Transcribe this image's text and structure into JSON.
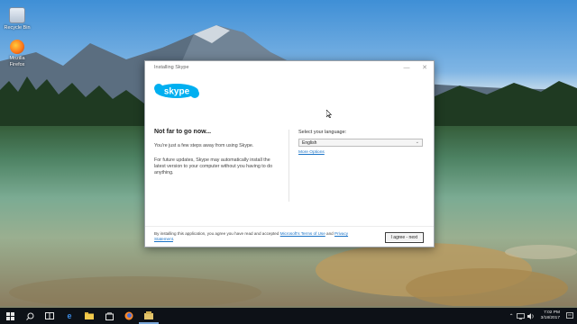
{
  "desktop": {
    "icons": [
      {
        "label": "Recycle Bin",
        "icon": "recycle-bin-icon"
      },
      {
        "label": "Mozilla Firefox",
        "icon": "firefox-icon"
      }
    ]
  },
  "installer": {
    "title": "Installing Skype",
    "logo_text": "skype",
    "heading": "Not far to go now...",
    "intro": "You're just a few steps away from using Skype.",
    "updates_note": "For future updates, Skype may automatically install the latest version to your computer without you having to do anything.",
    "language_label": "Select your language:",
    "language_value": "English",
    "more_options": "More Options",
    "footer_prefix": "By installing this application, you agree you have read and accepted",
    "terms_link": "Microsoft's Terms of Use",
    "footer_and": "and",
    "privacy_link": "Privacy Statement",
    "footer_end": ".",
    "agree_button": "I agree - next"
  },
  "taskbar": {
    "items": [
      "start-icon",
      "search-icon",
      "task-view-icon",
      "edge-icon",
      "file-explorer-icon",
      "store-icon",
      "firefox-icon",
      "installer-icon"
    ],
    "time": "7:02 PM",
    "date": "3/18/2017"
  },
  "colors": {
    "accent": "#00aff0",
    "link": "#1a73c7",
    "taskbar": "#0d1117"
  }
}
